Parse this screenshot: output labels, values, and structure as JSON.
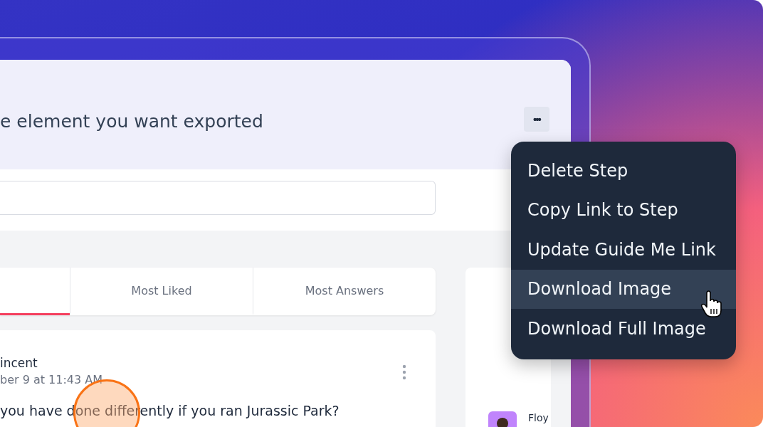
{
  "step": {
    "title": "e element you want exported",
    "more_button": "•••"
  },
  "tabs": [
    {
      "selected": true
    },
    {
      "label": "Most Liked",
      "selected": false
    },
    {
      "label": "Most Answers",
      "selected": false
    }
  ],
  "post": {
    "author": "incent",
    "date": "ber 9 at 11:43 AM",
    "question": "you have done differently if you ran Jurassic Park?"
  },
  "side_card": {
    "name": "Floy"
  },
  "menu": [
    {
      "label": "Delete Step",
      "selected": false
    },
    {
      "label": "Copy Link to Step",
      "selected": false
    },
    {
      "label": "Update Guide Me Link",
      "selected": false
    },
    {
      "label": "Download Image",
      "selected": true
    },
    {
      "label": "Download Full Image",
      "selected": false
    }
  ]
}
